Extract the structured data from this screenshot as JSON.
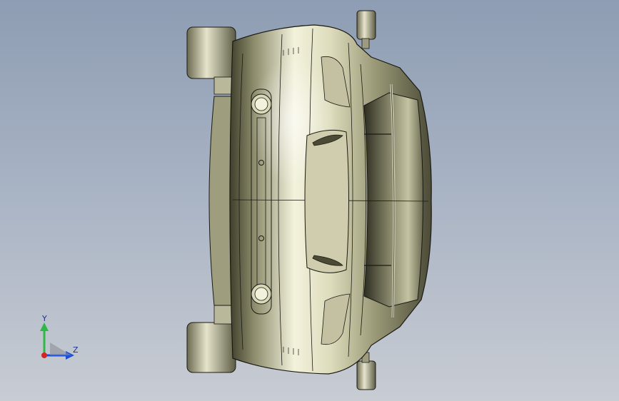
{
  "viewport": {
    "background_top": "#8e9db3",
    "background_bottom": "#c8ccd3"
  },
  "model": {
    "view": "front",
    "body_color": "#c9c8a2",
    "shadow_color": "#4a4a35",
    "edge_color": "#1a1a14"
  },
  "triad": {
    "y_label": "Y",
    "z_label": "Z",
    "y_color": "#2fb84a",
    "z_color": "#1d4fd6",
    "x_color": "#d62424"
  }
}
